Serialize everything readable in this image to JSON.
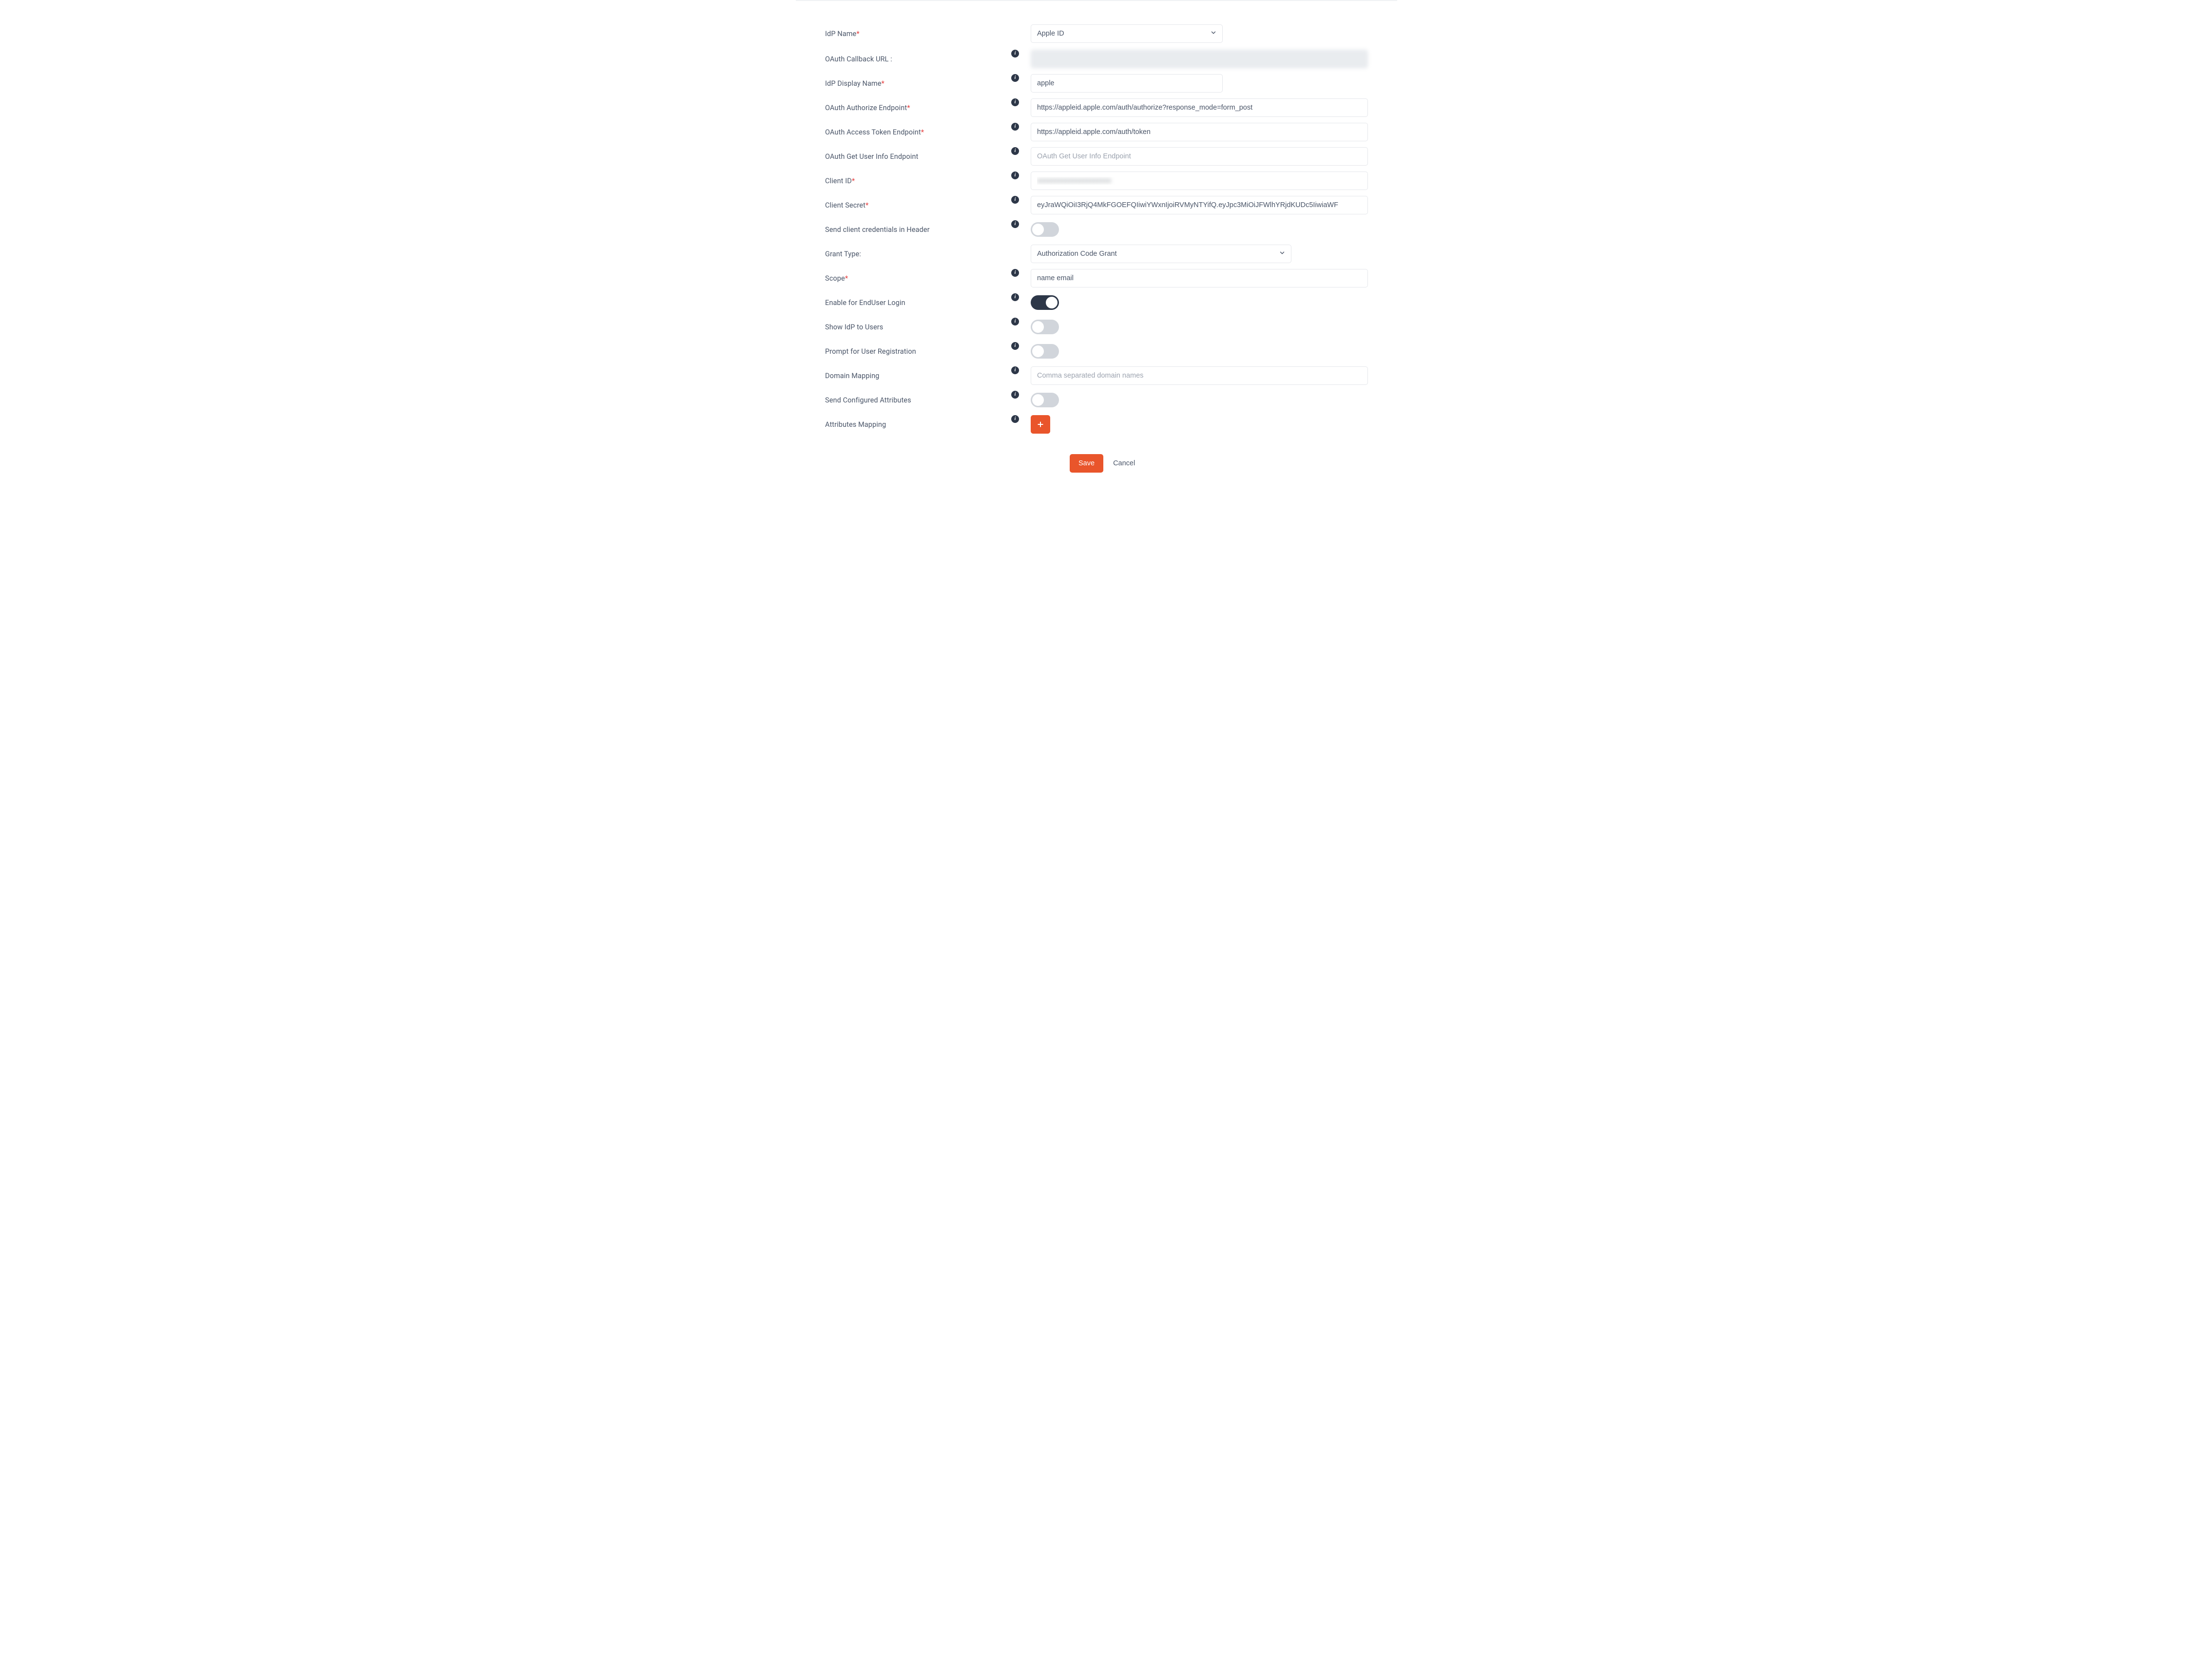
{
  "labels": {
    "idp_name": "IdP Name",
    "callback": "OAuth Callback URL :",
    "display_name": "IdP Display Name",
    "authorize": "OAuth Authorize Endpoint",
    "token": "OAuth Access Token Endpoint",
    "userinfo": "OAuth Get User Info Endpoint",
    "client_id": "Client ID",
    "client_secret": "Client Secret",
    "creds_header": "Send client credentials in Header",
    "grant_type": "Grant Type:",
    "scope": "Scope",
    "enable_enduser": "Enable for EndUser Login",
    "show_idp": "Show IdP to Users",
    "prompt_reg": "Prompt for User Registration",
    "domain_mapping": "Domain Mapping",
    "send_attrs": "Send Configured Attributes",
    "attrs_mapping": "Attributes Mapping"
  },
  "values": {
    "idp_name": "Apple ID",
    "callback": "",
    "display_name": "apple",
    "authorize": "https://appleid.apple.com/auth/authorize?response_mode=form_post",
    "token": "https://appleid.apple.com/auth/token",
    "userinfo": "",
    "client_id": "",
    "client_secret": "eyJraWQiOiI3RjQ4MkFGOEFQIiwiYWxnIjoiRVMyNTYifQ.eyJpc3MiOiJFWlhYRjdKUDc5IiwiaWF",
    "grant_type": "Authorization Code Grant",
    "scope": "name email",
    "domain_mapping": ""
  },
  "placeholders": {
    "userinfo": "OAuth Get User Info Endpoint",
    "domain_mapping": "Comma separated domain names"
  },
  "toggles": {
    "creds_header": false,
    "enable_enduser": true,
    "show_idp": false,
    "prompt_reg": false,
    "send_attrs": false
  },
  "buttons": {
    "save": "Save",
    "cancel": "Cancel"
  },
  "required_marker": "*",
  "info_glyph": "i"
}
